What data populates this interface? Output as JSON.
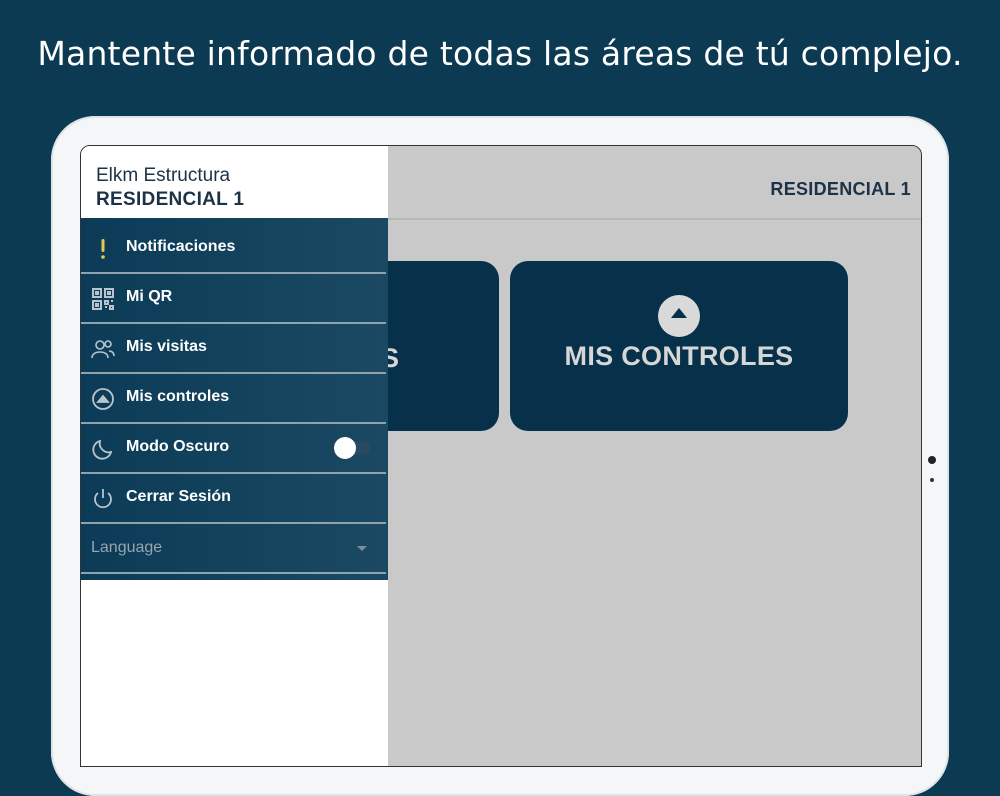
{
  "headline": "Mantente informado de todas las áreas de tú complejo.",
  "appbar": {
    "title": "RESIDENCIAL 1"
  },
  "cards": [
    {
      "label": "S"
    },
    {
      "label": "MIS CONTROLES",
      "icon": "eject-circle-icon"
    }
  ],
  "drawer": {
    "org": "Elkm Estructura",
    "residence": "RESIDENCIAL 1",
    "items": [
      {
        "label": "Notificaciones",
        "icon": "exclamation-icon"
      },
      {
        "label": "Mi QR",
        "icon": "qr-code-icon"
      },
      {
        "label": "Mis visitas",
        "icon": "people-icon"
      },
      {
        "label": "Mis controles",
        "icon": "eject-circle-icon"
      },
      {
        "label": "Modo Oscuro",
        "icon": "moon-icon",
        "toggle": false
      },
      {
        "label": "Cerrar Sesión",
        "icon": "power-icon"
      }
    ],
    "language": {
      "label": "Language"
    }
  },
  "colors": {
    "background": "#0c3a52",
    "card": "#07304a",
    "drawer_menu": "#0b3b57",
    "overlay": "#c9c9c9",
    "title": "#1d3246"
  }
}
